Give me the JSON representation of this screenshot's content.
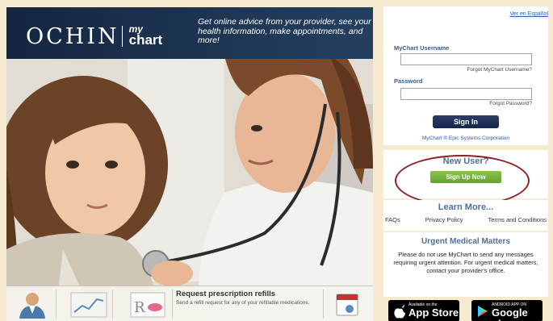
{
  "hero": {
    "brand": "OCHIN",
    "brand_my": "my",
    "brand_chart": "chart",
    "tagline": "Get online advice from your provider, see your health information, make appointments, and more!",
    "feature_title": "Request prescription refills",
    "feature_desc": "Send a refill request for any of your refillable medications."
  },
  "login": {
    "spanish_link": "Ver en Español",
    "username_label": "MyChart Username",
    "forgot_username": "Forgot MyChart Username?",
    "password_label": "Password",
    "forgot_password": "Forgot Password?",
    "signin_label": "Sign In",
    "epic_link": "MyChart ® Epic Systems Corporation"
  },
  "new_user": {
    "title": "New User?",
    "signup_label": "Sign Up Now"
  },
  "learn": {
    "title": "Learn More...",
    "faqs": "FAQs",
    "privacy": "Privacy Policy",
    "terms": "Terms and Conditions"
  },
  "urgent": {
    "title": "Urgent Medical Matters",
    "body": "Please do not use MyChart to send any messages requiring urgent attention. For urgent medical matters, contact your provider's office."
  },
  "stores": {
    "apple_small": "Available on the",
    "apple_big": "App Store",
    "google_small": "ANDROID APP ON",
    "google_big": "Google play"
  },
  "colors": {
    "header_navy": "#1e3653",
    "accent_blue": "#4e6f9e",
    "signup_green": "#6aab34",
    "highlight_ring": "#8b1f24",
    "page_bg": "#f6ead0"
  }
}
